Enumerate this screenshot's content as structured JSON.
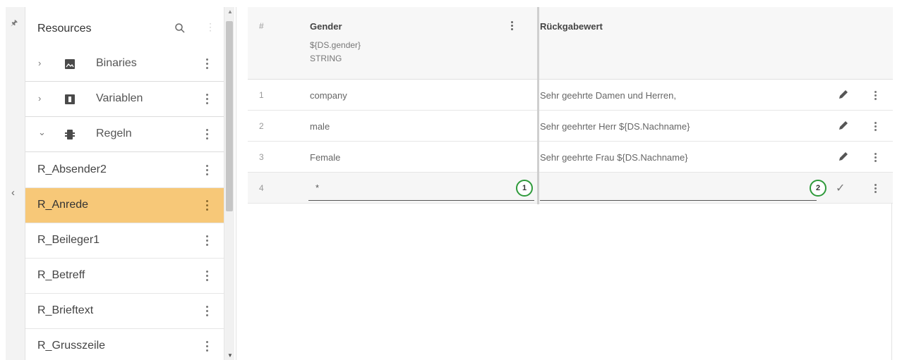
{
  "rail": {
    "pin_icon": "pin-icon",
    "collapse_icon": "chevron-left-icon"
  },
  "sidebar": {
    "title": "Resources",
    "groups": [
      {
        "label": "Binaries",
        "icon": "image-icon",
        "expanded": false
      },
      {
        "label": "Variablen",
        "icon": "variable-icon",
        "expanded": false
      },
      {
        "label": "Regeln",
        "icon": "rules-icon",
        "expanded": true
      }
    ],
    "items": [
      {
        "label": "R_Absender2",
        "selected": false
      },
      {
        "label": "R_Anrede",
        "selected": true
      },
      {
        "label": "R_Beileger1",
        "selected": false
      },
      {
        "label": "R_Betreff",
        "selected": false
      },
      {
        "label": "R_Brieftext",
        "selected": false
      },
      {
        "label": "R_Grusszeile",
        "selected": false
      }
    ]
  },
  "table": {
    "headers": {
      "index": "#",
      "gender": "Gender",
      "gender_expr": "${DS.gender}",
      "gender_type": "STRING",
      "return": "Rückgabewert"
    },
    "rows": [
      {
        "num": "1",
        "gender": "company",
        "return": "Sehr geehrte Damen und Herren,"
      },
      {
        "num": "2",
        "gender": "male",
        "return": "Sehr geehrter Herr ${DS.Nachname}"
      },
      {
        "num": "3",
        "gender": "Female",
        "return": "Sehr geehrte Frau ${DS.Nachname}"
      }
    ],
    "edit_row": {
      "num": "4",
      "gender_value": "*",
      "return_value": ""
    },
    "markers": [
      "1",
      "2"
    ]
  },
  "colors": {
    "selected": "#f7c878",
    "marker": "#2e9a3a",
    "header_bg": "#f7f7f7"
  }
}
